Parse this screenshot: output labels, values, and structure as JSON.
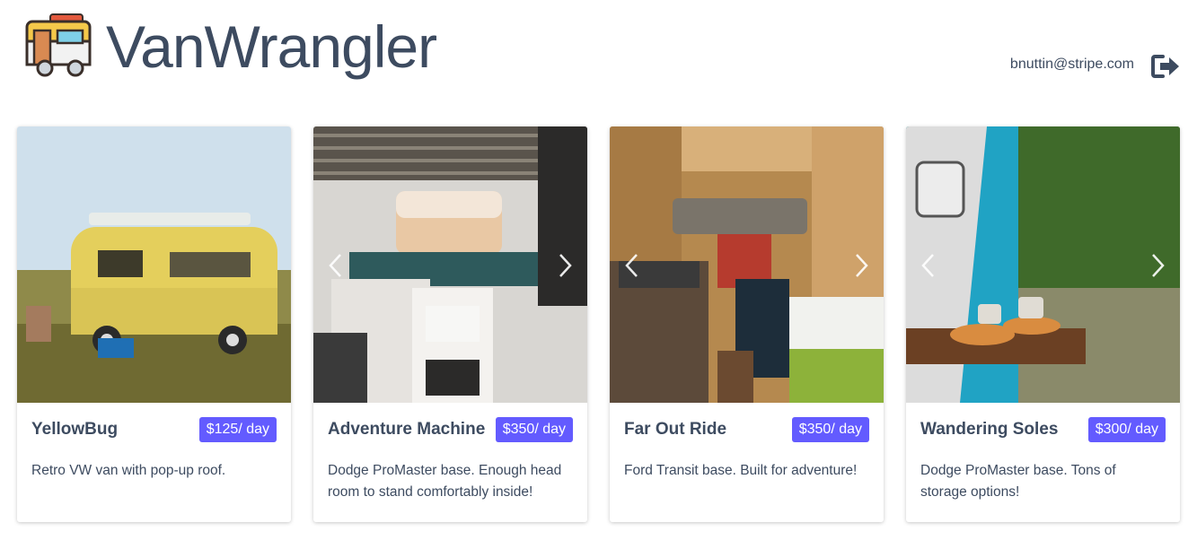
{
  "header": {
    "brand": "VanWrangler",
    "user_email": "bnuttin@stripe.com"
  },
  "icons": {
    "logo": "camper-van-logo-icon",
    "logout": "logout-icon",
    "prev": "chevron-left-icon",
    "next": "chevron-right-icon"
  },
  "colors": {
    "accent": "#635bff",
    "text": "#3d4b60"
  },
  "vans": [
    {
      "name": "YellowBug",
      "price": "$125/ day",
      "description": "Retro VW van with pop-up roof."
    },
    {
      "name": "Adventure Machine",
      "price": "$350/ day",
      "description": "Dodge ProMaster base. Enough head room to stand comfortably inside!"
    },
    {
      "name": "Far Out Ride",
      "price": "$350/ day",
      "description": "Ford Transit base. Built for adventure!"
    },
    {
      "name": "Wandering Soles",
      "price": "$300/ day",
      "description": "Dodge ProMaster base. Tons of storage options!"
    }
  ]
}
